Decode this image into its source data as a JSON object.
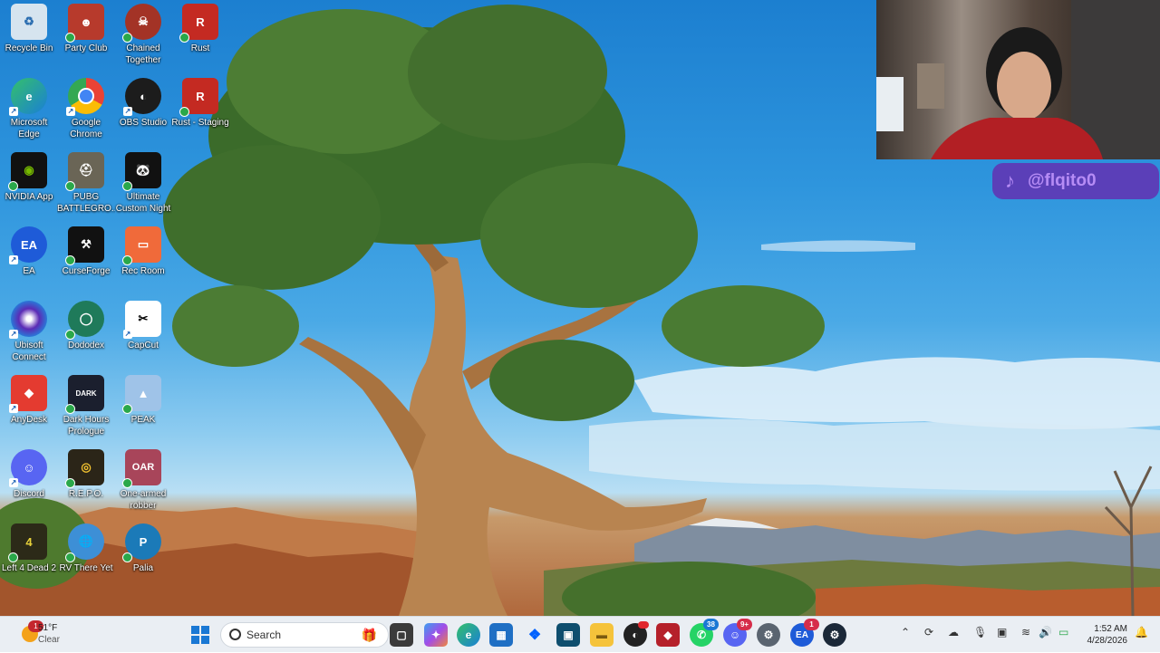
{
  "desktop": {
    "icons": [
      {
        "label": "Recycle Bin",
        "icon": "recycle-bin-icon"
      },
      {
        "label": "Party Club",
        "icon": "party-club-icon"
      },
      {
        "label": "Chained Together",
        "icon": "chained-together-icon"
      },
      {
        "label": "Rust",
        "icon": "rust-icon"
      },
      {
        "label": "Microsoft Edge",
        "icon": "edge-icon"
      },
      {
        "label": "Google Chrome",
        "icon": "chrome-icon"
      },
      {
        "label": "OBS Studio",
        "icon": "obs-icon"
      },
      {
        "label": "Rust - Staging",
        "icon": "rust-staging-icon"
      },
      {
        "label": "NVIDIA App",
        "icon": "nvidia-icon"
      },
      {
        "label": "PUBG BATTLEGRO...",
        "icon": "pubg-icon"
      },
      {
        "label": "Ultimate Custom Night",
        "icon": "ucn-icon"
      },
      {
        "label": "EA",
        "icon": "ea-icon"
      },
      {
        "label": "CurseForge",
        "icon": "curseforge-icon"
      },
      {
        "label": "Rec Room",
        "icon": "rec-room-icon"
      },
      {
        "label": "Ubisoft Connect",
        "icon": "ubisoft-icon"
      },
      {
        "label": "Dododex",
        "icon": "dododex-icon"
      },
      {
        "label": "CapCut",
        "icon": "capcut-icon"
      },
      {
        "label": "AnyDesk",
        "icon": "anydesk-icon"
      },
      {
        "label": "Dark Hours Prologue",
        "icon": "dark-hours-icon"
      },
      {
        "label": "PEAK",
        "icon": "peak-icon"
      },
      {
        "label": "Discord",
        "icon": "discord-icon"
      },
      {
        "label": "R.E.P.O.",
        "icon": "repo-icon"
      },
      {
        "label": "One-armed robber",
        "icon": "one-armed-robber-icon"
      },
      {
        "label": "Left 4 Dead 2",
        "icon": "left4dead2-icon"
      },
      {
        "label": "RV There Yet",
        "icon": "rv-there-yet-icon"
      },
      {
        "label": "Palia",
        "icon": "palia-icon"
      }
    ]
  },
  "overlay": {
    "tiktok_handle": "@flqito0"
  },
  "taskbar": {
    "weather": {
      "temp": "51°F",
      "condition": "Clear",
      "alert_count": "1"
    },
    "search_placeholder": "Search",
    "badges": {
      "whatsapp": "38",
      "discord": "9+",
      "ea": "1"
    },
    "clock": {
      "time": "1:52 AM",
      "date": "4/28/2026"
    }
  },
  "colors": {
    "taskbar_bg": "#eaeef3",
    "tiktok_badge": "#5b3fb8",
    "tiktok_text": "#b68cf5"
  }
}
